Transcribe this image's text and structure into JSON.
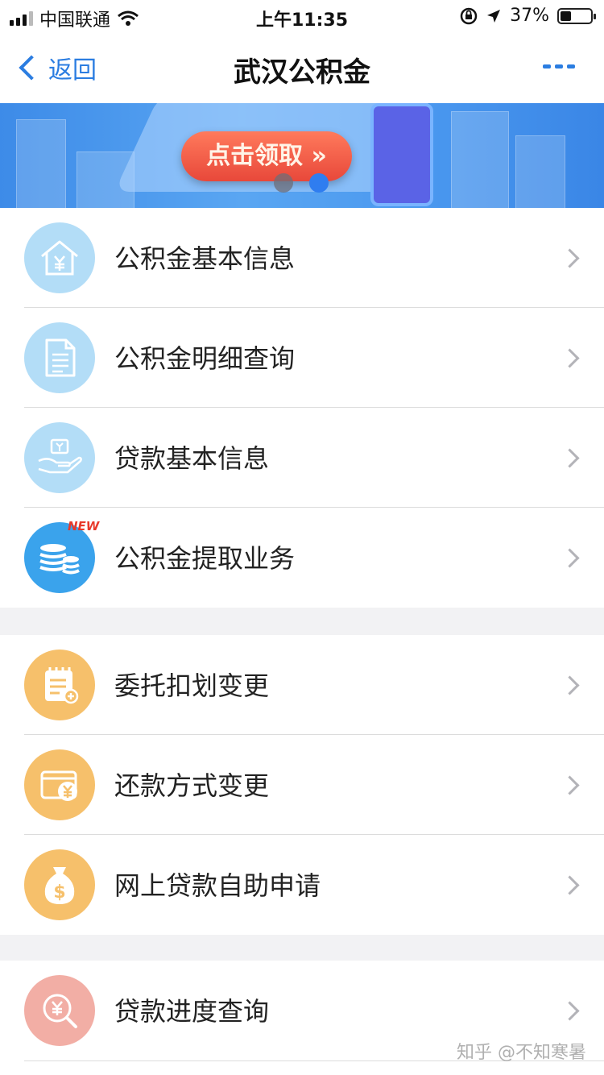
{
  "status_bar": {
    "carrier": "中国联通",
    "time": "上午11:35",
    "battery": "37%",
    "battery_level": 0.37
  },
  "nav": {
    "back_label": "返回",
    "title": "武汉公积金",
    "more_icon": "more-dots-icon"
  },
  "banner": {
    "cta_label": "点击领取 »",
    "carousel_active_index": 1,
    "carousel_count": 2
  },
  "groups": [
    {
      "items": [
        {
          "label": "公积金基本信息",
          "icon": "house-yuan-icon",
          "color": "#b3ddf7"
        },
        {
          "label": "公积金明细查询",
          "icon": "document-icon",
          "color": "#b3ddf7"
        },
        {
          "label": "贷款基本信息",
          "icon": "hand-money-icon",
          "color": "#b3ddf7"
        },
        {
          "label": "公积金提取业务",
          "icon": "coins-icon",
          "color": "#3aa3ec",
          "badge": "NEW"
        }
      ]
    },
    {
      "items": [
        {
          "label": "委托扣划变更",
          "icon": "edit-form-icon",
          "color": "#f6c06b"
        },
        {
          "label": "还款方式变更",
          "icon": "wallet-yuan-icon",
          "color": "#f6c06b"
        },
        {
          "label": "网上贷款自助申请",
          "icon": "money-bag-icon",
          "color": "#f6c06b"
        }
      ]
    },
    {
      "items": [
        {
          "label": "贷款进度查询",
          "icon": "search-yuan-icon",
          "color": "#f2aea5"
        }
      ]
    }
  ],
  "watermark": "知乎 @不知寒暑"
}
